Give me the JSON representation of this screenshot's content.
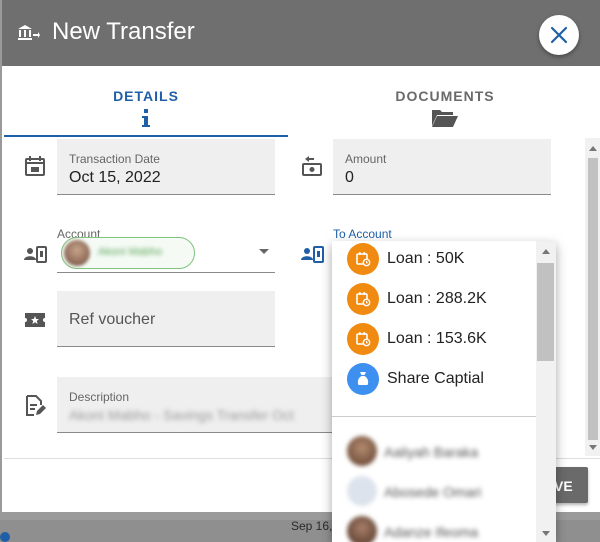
{
  "background": {
    "date_text": "Sep 16,"
  },
  "header": {
    "title": "New Transfer",
    "icon": "bank-transfer-icon",
    "close_icon": "close-icon"
  },
  "tabs": [
    {
      "label": "DETAILS",
      "icon": "info-icon",
      "active": true
    },
    {
      "label": "DOCUMENTS",
      "icon": "folder-open-icon",
      "active": false
    }
  ],
  "form": {
    "transaction_date": {
      "label": "Transaction Date",
      "value": "Oct 15, 2022"
    },
    "amount": {
      "label": "Amount",
      "value": "0"
    },
    "account": {
      "label": "Account",
      "chip_name": "Akoni Mabho"
    },
    "to_account": {
      "label": "To Account"
    },
    "ref_voucher": {
      "placeholder": "Ref voucher"
    },
    "description": {
      "label": "Description",
      "value": "Akoni Mabho - Savings Transfer Oct"
    }
  },
  "dropdown": {
    "items": [
      {
        "label": "Loan : 50K",
        "icon": "loan-icon"
      },
      {
        "label": "Loan : 288.2K",
        "icon": "loan-icon"
      },
      {
        "label": "Loan : 153.6K",
        "icon": "loan-icon"
      },
      {
        "label": "Share Captial",
        "icon": "money-bag-icon"
      }
    ],
    "people": [
      {
        "name": "Aaliyah Baraka"
      },
      {
        "name": "Abosede Omari"
      },
      {
        "name": "Adanze Ifeoma"
      }
    ]
  },
  "footer": {
    "save_label": "VE"
  },
  "colors": {
    "accent": "#1f5fa8",
    "header": "#6f6f6f",
    "loan": "#f08a10",
    "share": "#3d8ff0"
  }
}
